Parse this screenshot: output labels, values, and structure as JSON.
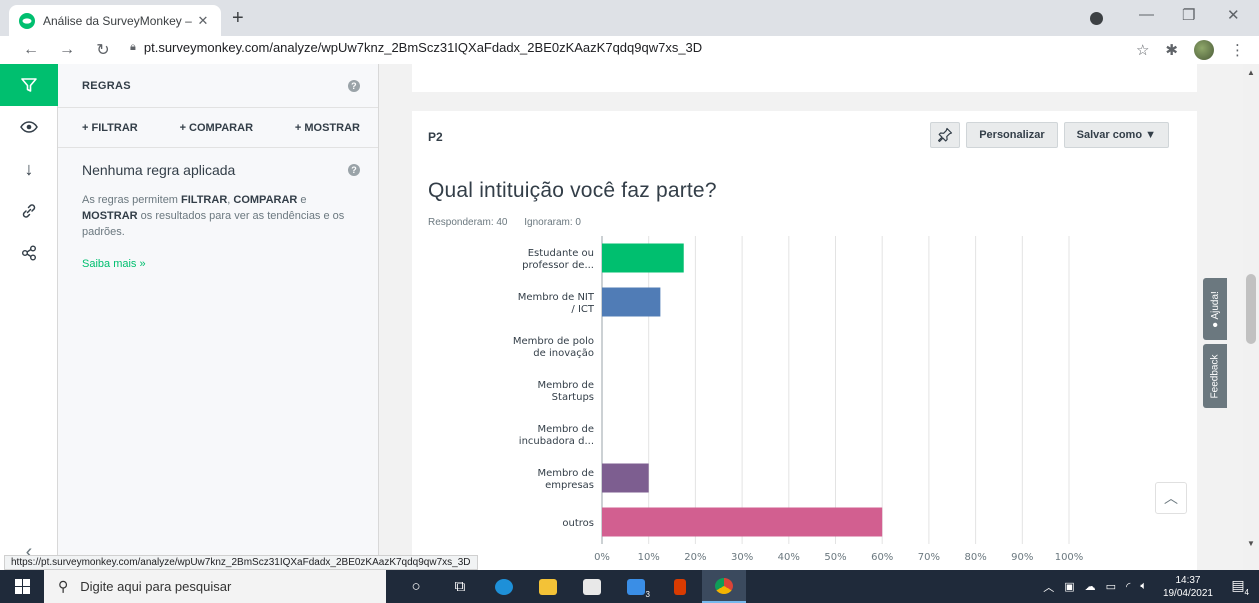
{
  "browser": {
    "tab_title": "Análise da SurveyMonkey – Pesq",
    "tab_close": "✕",
    "new_tab": "+",
    "url": "pt.surveymonkey.com/analyze/wpUw7knz_2BmScz31IQXaFdadx_2BE0zKAazK7qdq9qw7xs_3D",
    "status_url": "https://pt.surveymonkey.com/analyze/wpUw7knz_2BmScz31IQXaFdadx_2BE0zKAazK7qdq9qw7xs_3D"
  },
  "sidebar": {
    "header": "REGRAS",
    "actions": [
      "+ FILTRAR",
      "+ COMPARAR",
      "+ MOSTRAR"
    ],
    "rule_title": "Nenhuma regra aplicada",
    "desc_1": "As regras permitem ",
    "desc_filtrar": "FILTRAR",
    "desc_2": ", ",
    "desc_comparar": "COMPARAR",
    "desc_3": " e ",
    "desc_mostrar": "MOSTRAR",
    "desc_4": " os resultados para ver as tendências e os padrões.",
    "learn_more": "Saiba mais »"
  },
  "question": {
    "number": "P2",
    "pin_icon": "pin-icon",
    "customize": "Personalizar",
    "save_as": "Salvar como ▼",
    "title": "Qual intituição você faz parte?",
    "answered": "Responderam: 40",
    "skipped": "Ignoraram: 0"
  },
  "chart_data": {
    "type": "bar",
    "orientation": "horizontal",
    "categories": [
      [
        "Estudante ou",
        "professor de..."
      ],
      [
        "Membro de NIT",
        "/ ICT"
      ],
      [
        "Membro de polo",
        "de inovação"
      ],
      [
        "Membro de",
        "Startups"
      ],
      [
        "Membro de",
        "incubadora d..."
      ],
      [
        "Membro de",
        "empresas"
      ],
      [
        "outros"
      ]
    ],
    "values": [
      17.5,
      12.5,
      0,
      0,
      0,
      10,
      60
    ],
    "colors": [
      "#00bf6f",
      "#507cb6",
      "#6bc8cd",
      "#f9be00",
      "#d25f90",
      "#7d5e90",
      "#d25f90"
    ],
    "x_ticks": [
      "0%",
      "10%",
      "20%",
      "30%",
      "40%",
      "50%",
      "60%",
      "70%",
      "80%",
      "90%",
      "100%"
    ],
    "xlim": [
      0,
      100
    ],
    "grid": true
  },
  "side_tabs": {
    "help": "Ajuda!",
    "feedback": "Feedback"
  },
  "taskbar": {
    "search_placeholder": "Digite aqui para pesquisar",
    "time": "14:37",
    "date": "19/04/2021",
    "mail_badge": "3",
    "notif_badge": "4"
  }
}
